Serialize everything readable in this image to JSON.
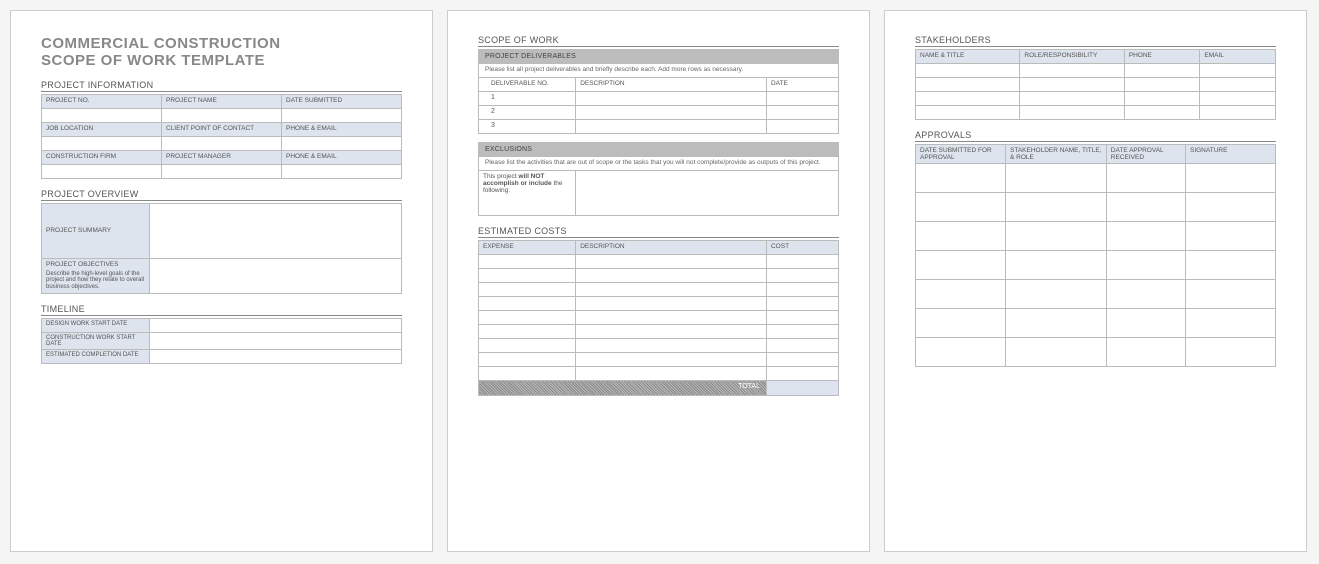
{
  "title_line1": "COMMERCIAL CONSTRUCTION",
  "title_line2": "SCOPE OF WORK TEMPLATE",
  "sections": {
    "project_information": "PROJECT INFORMATION",
    "project_overview": "PROJECT OVERVIEW",
    "timeline": "TIMELINE",
    "scope_of_work": "SCOPE OF WORK",
    "estimated_costs": "ESTIMATED COSTS",
    "stakeholders": "STAKEHOLDERS",
    "approvals": "APPROVALS"
  },
  "project_info": {
    "row1": [
      "PROJECT NO.",
      "PROJECT NAME",
      "DATE SUBMITTED"
    ],
    "row2": [
      "JOB LOCATION",
      "CLIENT POINT OF CONTACT",
      "PHONE & EMAIL"
    ],
    "row3": [
      "CONSTRUCTION FIRM",
      "PROJECT MANAGER",
      "PHONE & EMAIL"
    ]
  },
  "overview": {
    "summary_label": "PROJECT SUMMARY",
    "objectives_label": "PROJECT OBJECTIVES",
    "objectives_desc": "Describe the high-level goals of the project and how they relate to overall business objectives."
  },
  "timeline": {
    "r1": "DESIGN WORK START DATE",
    "r2": "CONSTRUCTION WORK START DATE",
    "r3": "ESTIMATED COMPLETION DATE"
  },
  "deliverables": {
    "title": "PROJECT DELIVERABLES",
    "desc": "Please list all project deliverables and briefly describe each. Add more rows as necessary.",
    "cols": [
      "DELIVERABLE NO.",
      "DESCRIPTION",
      "DATE"
    ],
    "rows": [
      "1",
      "2",
      "3"
    ]
  },
  "exclusions": {
    "title": "EXCLUSIONS",
    "desc": "Please list the activities that are out of scope or the tasks that you will not complete/provide as outputs of this project.",
    "left_label_a": "This project ",
    "left_label_b": "will NOT accomplish or include",
    "left_label_c": " the following:"
  },
  "costs": {
    "cols": [
      "EXPENSE",
      "DESCRIPTION",
      "COST"
    ],
    "total_label": "TOTAL"
  },
  "stakeholders_cols": [
    "NAME & TITLE",
    "ROLE/RESPONSIBILITY",
    "PHONE",
    "EMAIL"
  ],
  "approvals_cols": [
    "DATE SUBMITTED FOR APPROVAL",
    "STAKEHOLDER NAME, TITLE, & ROLE",
    "DATE APPROVAL RECEIVED",
    "SIGNATURE"
  ]
}
